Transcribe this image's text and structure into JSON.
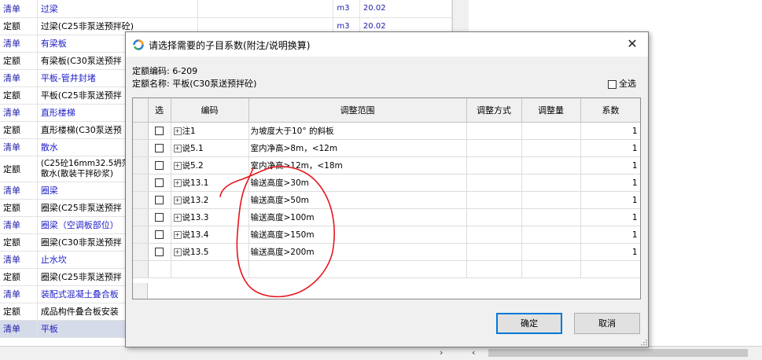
{
  "background_rows": [
    {
      "type": "清单",
      "name": "过梁",
      "unit": "m3",
      "qty": "20.02",
      "kind": "qd"
    },
    {
      "type": "定额",
      "name": "过梁(C25非泵送预拌砼)",
      "unit": "m3",
      "qty": "20.02",
      "kind": "de"
    },
    {
      "type": "清单",
      "name": "有梁板",
      "unit": "",
      "qty": "",
      "kind": "qd"
    },
    {
      "type": "定额",
      "name": "有梁板(C30泵送预拌",
      "unit": "",
      "qty": "",
      "kind": "de"
    },
    {
      "type": "清单",
      "name": "平板-管井封堵",
      "unit": "",
      "qty": "",
      "kind": "qd"
    },
    {
      "type": "定额",
      "name": "平板(C25非泵送预拌",
      "unit": "",
      "qty": "",
      "kind": "de"
    },
    {
      "type": "清单",
      "name": "直形楼梯",
      "unit": "",
      "qty": "",
      "kind": "qd"
    },
    {
      "type": "定额",
      "name": "直形楼梯(C30泵送预",
      "unit": "",
      "qty": "",
      "kind": "de"
    },
    {
      "type": "清单",
      "name": "散水",
      "unit": "",
      "qty": "",
      "kind": "qd"
    },
    {
      "type": "定额",
      "name": "(C25砼16mm32.5坍落\n散水(散装干拌砂浆)",
      "unit": "",
      "qty": "",
      "kind": "de",
      "tall": true
    },
    {
      "type": "清单",
      "name": "圈梁",
      "unit": "",
      "qty": "",
      "kind": "qd"
    },
    {
      "type": "定额",
      "name": "圈梁(C25非泵送预拌",
      "unit": "",
      "qty": "",
      "kind": "de"
    },
    {
      "type": "清单",
      "name": "圈梁（空调板部位）",
      "unit": "",
      "qty": "",
      "kind": "qd"
    },
    {
      "type": "定额",
      "name": "圈梁(C30非泵送预拌",
      "unit": "",
      "qty": "",
      "kind": "de"
    },
    {
      "type": "清单",
      "name": "止水坎",
      "unit": "",
      "qty": "",
      "kind": "qd"
    },
    {
      "type": "定额",
      "name": "圈梁(C25非泵送预拌",
      "unit": "",
      "qty": "",
      "kind": "de"
    },
    {
      "type": "清单",
      "name": "装配式混凝土叠合板",
      "unit": "",
      "qty": "",
      "kind": "qd"
    },
    {
      "type": "定额",
      "name": "成品构件叠合板安装",
      "unit": "",
      "qty": "",
      "kind": "de"
    },
    {
      "type": "清单",
      "name": "平板",
      "unit": "",
      "qty": "",
      "kind": "qd",
      "selected": true
    }
  ],
  "scroll": {
    "right_arrow": "›",
    "left_arrow": "‹"
  },
  "dialog": {
    "title": "请选择需要的子目系数(附注/说明换算)",
    "close": "✕",
    "code_label": "定额编码: 6-209",
    "name_label": "定额名称: 平板(C30泵送预拌砼)",
    "select_all_label": "全选",
    "ok_label": "确定",
    "cancel_label": "取消",
    "accent_color": "#0078d7"
  },
  "grid": {
    "headers": {
      "select": "选",
      "code": "编码",
      "range": "调整范围",
      "mode": "调整方式",
      "amount": "调整量",
      "coef": "系数"
    },
    "rows": [
      {
        "code": "注1",
        "range": "为坡度大于10° 的斜板",
        "coef": "1"
      },
      {
        "code": "说5.1",
        "range": "室内净高>8m，<12m",
        "coef": "1"
      },
      {
        "code": "说5.2",
        "range": "室内净高>12m，<18m",
        "coef": "1"
      },
      {
        "code": "说13.1",
        "range": "输送高度>30m",
        "coef": "1"
      },
      {
        "code": "说13.2",
        "range": "输送高度>50m",
        "coef": "1"
      },
      {
        "code": "说13.3",
        "range": "输送高度>100m",
        "coef": "1"
      },
      {
        "code": "说13.4",
        "range": "输送高度>150m",
        "coef": "1"
      },
      {
        "code": "说13.5",
        "range": "输送高度>200m",
        "coef": "1"
      }
    ]
  },
  "annotation": {
    "color": "#e8141c"
  }
}
